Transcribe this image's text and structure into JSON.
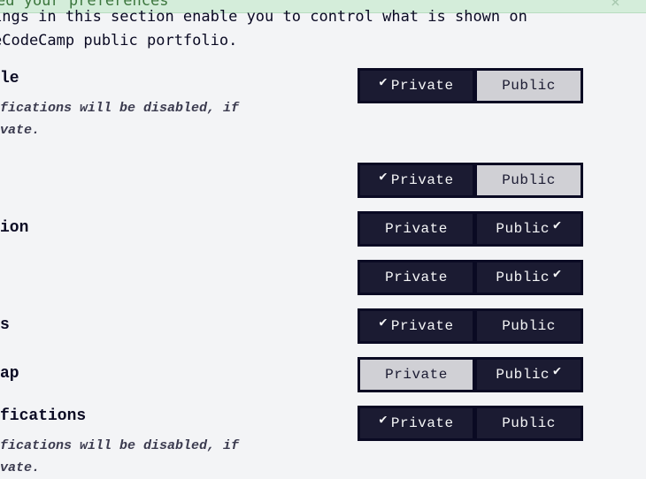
{
  "banner": {
    "text": "ed your preferences",
    "close_icon": "×"
  },
  "intro": {
    "line1": "ings in this section enable you to control what is shown on",
    "line2": "eCodeCamp public portfolio."
  },
  "check_icon": "✔",
  "settings": [
    {
      "label": "le",
      "note": [
        "fications will be disabled, if",
        "vate."
      ],
      "private_label": "Private",
      "public_label": "Public",
      "selected": "private"
    },
    {
      "label": "",
      "note": [],
      "private_label": "Private",
      "public_label": "Public",
      "selected": "private"
    },
    {
      "label": "ion",
      "note": [],
      "private_label": "Private",
      "public_label": "Public",
      "selected": "public"
    },
    {
      "label": "",
      "note": [],
      "private_label": "Private",
      "public_label": "Public",
      "selected": "public"
    },
    {
      "label": "s",
      "note": [],
      "private_label": "Private",
      "public_label": "Public",
      "selected": "private"
    },
    {
      "label": "ap",
      "note": [],
      "private_label": "Private",
      "public_label": "Public",
      "selected": "public"
    },
    {
      "label": "fications",
      "note": [
        "fications will be disabled, if",
        "vate."
      ],
      "private_label": "Private",
      "public_label": "Public",
      "selected": "private"
    }
  ]
}
